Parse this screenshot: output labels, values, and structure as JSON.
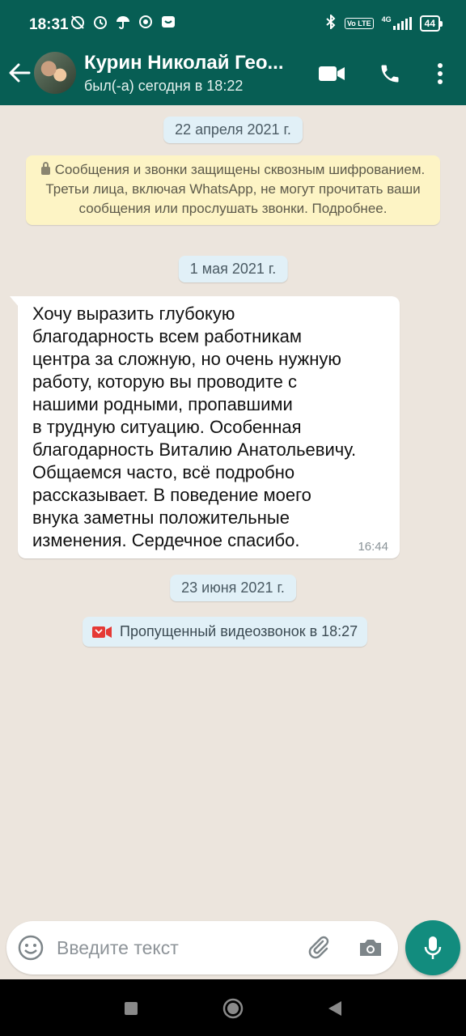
{
  "status_bar": {
    "time": "18:31",
    "battery": "44",
    "network": "4G",
    "volte": "Vo LTE",
    "icons": [
      "alarm-off-icon",
      "alarm-icon",
      "umbrella-icon",
      "app-icon",
      "notification-icon",
      "bluetooth-icon",
      "signal-icon"
    ]
  },
  "header": {
    "contact_name": "Курин Николай Гео...",
    "last_seen": "был(-а) сегодня в 18:22",
    "icons": [
      "back-arrow-icon",
      "avatar",
      "video-call-icon",
      "phone-icon",
      "more-vert-icon"
    ],
    "accent_color": "#075e54"
  },
  "chat": {
    "date_1": "22 апреля 2021 г.",
    "encryption_notice": "Сообщения и звонки защищены сквозным шифрованием. Третьи лица, включая WhatsApp, не могут прочитать ваши сообщения или прослушать звонки. Подробнее.",
    "date_2": "1 мая 2021 г.",
    "message": {
      "text": "Хочу выразить глубокую\nблагодарность всем работникам\nцентра за сложную, но очень нужную\nработу, которую вы проводите с\nнашими родными, пропавшими\nв трудную ситуацию. Особенная\nблагодарность Виталию Анатольевичу.\nОбщаемся часто, всё подробно\nрассказывает. В поведение моего\nвнука заметны положительные\nизменения. Сердечное спасибо.",
      "time": "16:44"
    },
    "date_3": "23 июня 2021 г.",
    "missed_call": "Пропущенный видеозвонок в 18:27"
  },
  "input": {
    "placeholder": "Введите текст",
    "icons": [
      "emoji-icon",
      "attach-icon",
      "camera-icon",
      "mic-icon"
    ],
    "mic_color": "#128c7e"
  },
  "nav": {
    "icons": [
      "recents-icon",
      "home-icon",
      "back-icon"
    ]
  }
}
